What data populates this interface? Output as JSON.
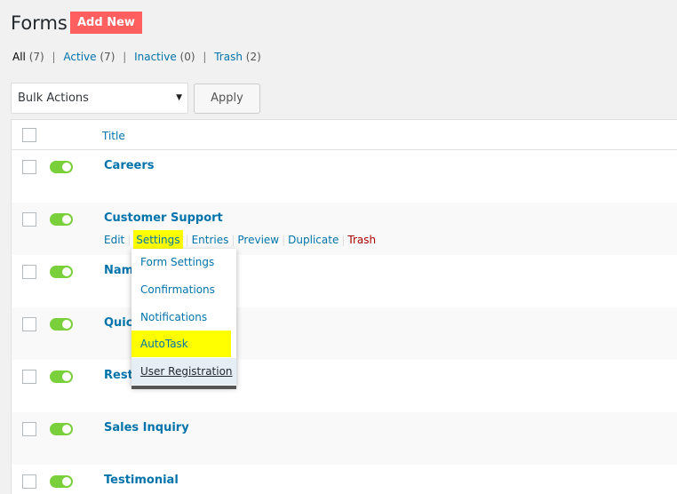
{
  "header": {
    "title": "Forms",
    "add_new_label": "Add New"
  },
  "filters": {
    "all": {
      "label": "All",
      "count": "(7)"
    },
    "active": {
      "label": "Active",
      "count": "(7)"
    },
    "inactive": {
      "label": "Inactive",
      "count": "(0)"
    },
    "trash": {
      "label": "Trash",
      "count": "(2)"
    },
    "separator": "|"
  },
  "bulk": {
    "selected": "Bulk Actions",
    "apply_label": "Apply"
  },
  "table": {
    "title_header": "Title",
    "rows": [
      {
        "title": "Careers",
        "active": true
      },
      {
        "title": "Customer Support",
        "active": true
      },
      {
        "title": "Name",
        "active": true
      },
      {
        "title": "Quick",
        "active": true
      },
      {
        "title": "Restr",
        "active": true
      },
      {
        "title": "Sales Inquiry",
        "active": true
      },
      {
        "title": "Testimonial",
        "active": true
      }
    ]
  },
  "row_actions": {
    "edit": "Edit",
    "settings": "Settings",
    "entries": "Entries",
    "preview": "Preview",
    "duplicate": "Duplicate",
    "trash": "Trash",
    "separator": "|"
  },
  "settings_menu": {
    "items": [
      "Form Settings",
      "Confirmations",
      "Notifications",
      "AutoTask",
      "User Registration"
    ]
  },
  "colors": {
    "accent": "#0073aa",
    "add_new_bg": "#ff5f5f",
    "toggle_on": "#7ad03a",
    "highlight": "#ffff00",
    "trash": "#a00"
  }
}
